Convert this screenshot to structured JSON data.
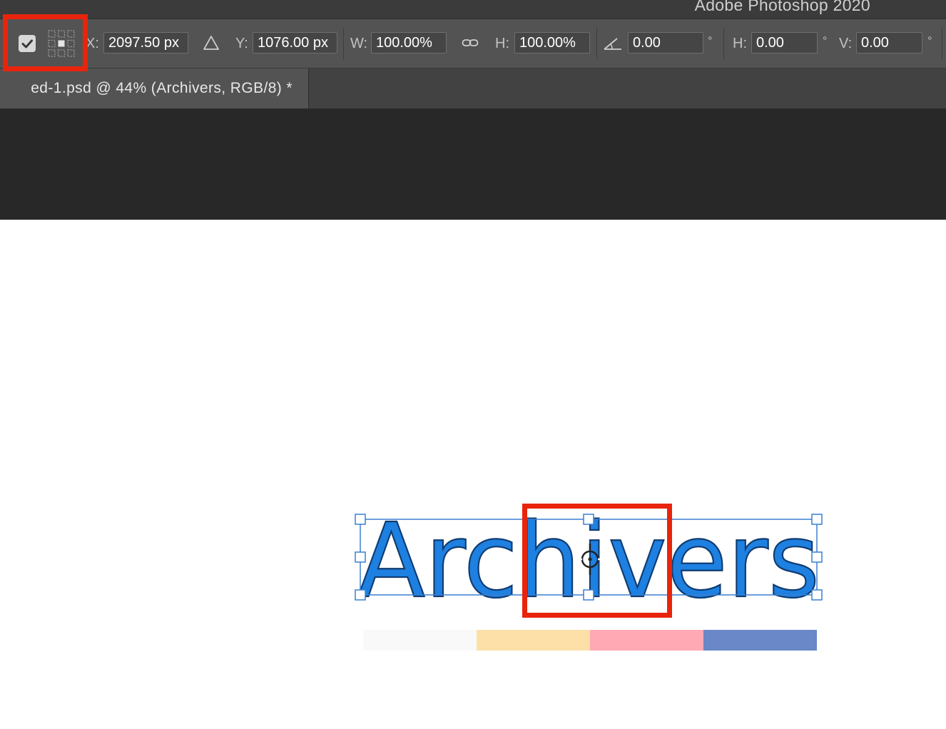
{
  "app": {
    "title": "Adobe Photoshop 2020"
  },
  "options_bar": {
    "commit_checkbox_checked": true,
    "reference_point_icon": "reference-point-grid-icon",
    "x_label": "X:",
    "x_value": "2097.50 px",
    "delta_icon": "delta-triangle-icon",
    "y_label": "Y:",
    "y_value": "1076.00 px",
    "w_label": "W:",
    "w_value": "100.00%",
    "link_icon": "link-chain-icon",
    "h_label": "H:",
    "h_value": "100.00%",
    "angle_icon": "rotate-angle-icon",
    "angle_value": "0.00",
    "angle_unit": "°",
    "skew_h_label": "H:",
    "skew_h_value": "0.00",
    "skew_h_unit": "°",
    "skew_v_label": "V:",
    "skew_v_value": "0.00",
    "skew_v_unit": "°"
  },
  "document_tab": {
    "title": "ed-1.psd @ 44% (Archivers, RGB/8) *"
  },
  "canvas": {
    "text_layer": "Archivers",
    "text_color": "#1e80e0",
    "swatches": [
      {
        "name": "off-white",
        "color": "#f9f9f9"
      },
      {
        "name": "peach",
        "color": "#fce0a8"
      },
      {
        "name": "pink",
        "color": "#ffa9b4"
      },
      {
        "name": "blue",
        "color": "#6a88c8"
      }
    ]
  },
  "highlight_color": "#e8250c"
}
